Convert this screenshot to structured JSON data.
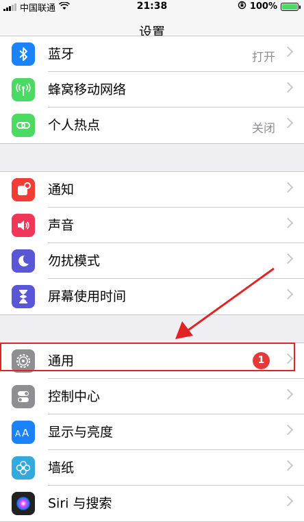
{
  "status_bar": {
    "carrier": "中国联通",
    "time": "21:38",
    "battery": "100%"
  },
  "nav": {
    "title": "设置"
  },
  "groups": [
    {
      "rows": [
        {
          "label": "蓝牙",
          "value": "打开",
          "icon": "bluetooth-icon",
          "color": "#1a82fb"
        },
        {
          "label": "蜂窝移动网络",
          "value": "",
          "icon": "cellular-icon",
          "color": "#4cd964"
        },
        {
          "label": "个人热点",
          "value": "关闭",
          "icon": "hotspot-icon",
          "color": "#4cd964"
        }
      ]
    },
    {
      "rows": [
        {
          "label": "通知",
          "value": "",
          "icon": "notifications-icon",
          "color": "#f23c35"
        },
        {
          "label": "声音",
          "value": "",
          "icon": "sounds-icon",
          "color": "#f2365a"
        },
        {
          "label": "勿扰模式",
          "value": "",
          "icon": "do-not-disturb-icon",
          "color": "#5a57d6"
        },
        {
          "label": "屏幕使用时间",
          "value": "",
          "icon": "screen-time-icon",
          "color": "#5a57d6"
        }
      ]
    },
    {
      "rows": [
        {
          "label": "通用",
          "value": "",
          "badge": "1",
          "icon": "gear-icon",
          "color": "#8e8e93"
        },
        {
          "label": "控制中心",
          "value": "",
          "icon": "control-center-icon",
          "color": "#8e8e93"
        },
        {
          "label": "显示与亮度",
          "value": "",
          "icon": "display-brightness-icon",
          "color": "#1a82fb"
        },
        {
          "label": "墙纸",
          "value": "",
          "icon": "wallpaper-icon",
          "color": "#34aadc"
        },
        {
          "label": "Siri 与搜索",
          "value": "",
          "icon": "siri-icon",
          "color": "#222222"
        }
      ]
    }
  ],
  "annotation": {
    "highlight_color": "#e02424"
  }
}
